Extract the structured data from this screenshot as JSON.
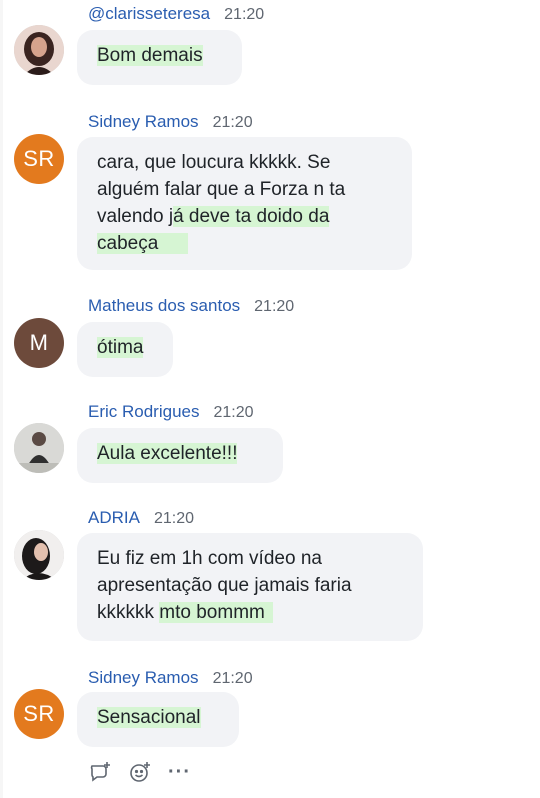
{
  "messages": [
    {
      "author": "@clarisseteresa",
      "time": "21:20",
      "avatar": {
        "type": "photo",
        "icon": "user-photo-avatar"
      },
      "text_plain": "",
      "text_highlight": "Bom demais"
    },
    {
      "author": "Sidney Ramos",
      "time": "21:20",
      "avatar": {
        "type": "initials",
        "initials": "SR",
        "color": "#e37a1e"
      },
      "lines": [
        {
          "plain": "cara, que loucura kkkkk. Se",
          "highlight": ""
        },
        {
          "plain": "alguém falar que a Forza n ta",
          "highlight": ""
        },
        {
          "plain": "valendo j",
          "highlight": "á deve ta doido da"
        },
        {
          "plain": "",
          "highlight": "cabeça"
        }
      ]
    },
    {
      "author": "Matheus dos santos",
      "time": "21:20",
      "avatar": {
        "type": "initials",
        "initials": "M",
        "color": "#6d4a3b"
      },
      "text_plain": "",
      "text_highlight": "ótima"
    },
    {
      "author": "Eric Rodrigues",
      "time": "21:20",
      "avatar": {
        "type": "photo",
        "icon": "user-photo-avatar"
      },
      "text_plain": "",
      "text_highlight": "Aula excelente!!!"
    },
    {
      "author": "ADRIA",
      "time": "21:20",
      "avatar": {
        "type": "photo",
        "icon": "user-photo-avatar"
      },
      "lines": [
        {
          "plain": "Eu fiz em 1h com vídeo na",
          "highlight": ""
        },
        {
          "plain": "apresentação que jamais faria",
          "highlight": ""
        },
        {
          "plain": "kkkkkk ",
          "highlight": "mto bommm"
        }
      ]
    },
    {
      "author": "Sidney Ramos",
      "time": "21:20",
      "avatar": {
        "type": "initials",
        "initials": "SR",
        "color": "#e37a1e"
      },
      "text_plain": "",
      "text_highlight": "Sensacional"
    }
  ],
  "reactions": {
    "icons": [
      "reply-thread-icon",
      "add-emoji-icon",
      "more-options-icon"
    ],
    "more_label": "···"
  },
  "colors": {
    "author_name": "#2a5db0",
    "bubble_bg": "#f2f3f6",
    "highlight": "#d6f5d3"
  }
}
